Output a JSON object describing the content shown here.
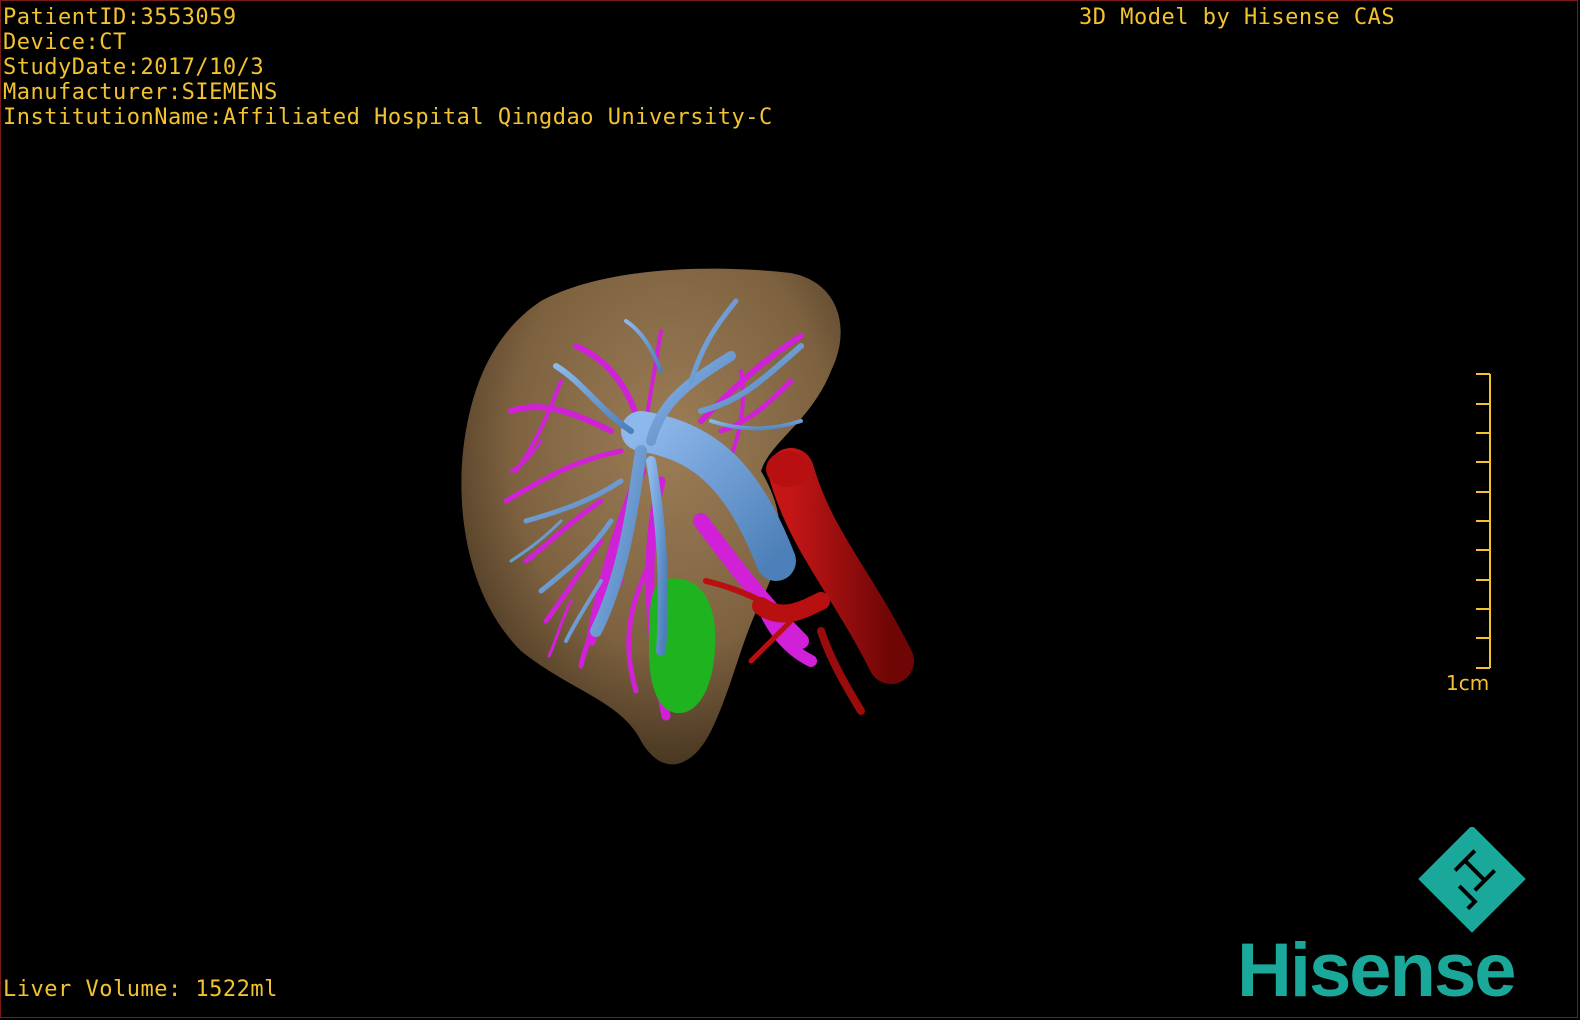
{
  "overlay": {
    "patient_id": "PatientID:3553059",
    "device": "Device:CT",
    "study_date": "StudyDate:2017/10/3",
    "manufacturer": "Manufacturer:SIEMENS",
    "institution": "InstitutionName:Affiliated Hospital Qingdao University-C",
    "credit": "3D Model by Hisense CAS",
    "liver_volume": "Liver Volume: 1522ml",
    "scale_label": "1cm"
  },
  "logo": {
    "text": "Hisense"
  },
  "colors": {
    "overlay_text": "#f2c230",
    "liver": "#8a6d4a",
    "portal_vein": "#6f9fd8",
    "hepatic_vessels": "#d020d8",
    "artery": "#a80e0e",
    "gallbladder": "#1fb41f",
    "logo": "#1aa89a"
  }
}
